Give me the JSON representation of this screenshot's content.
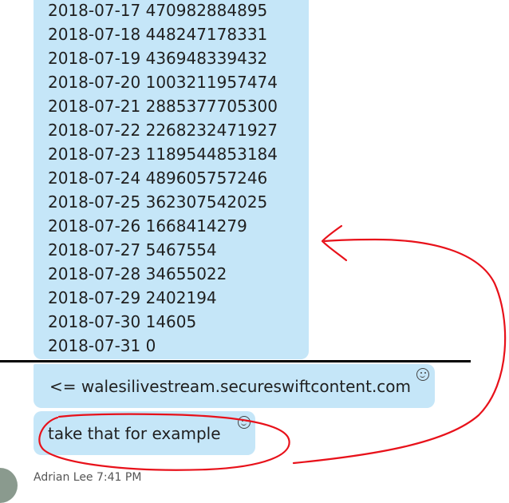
{
  "chat": {
    "log_lines": [
      "2018-07-17 470982884895",
      "2018-07-18 448247178331",
      "2018-07-19 436948339432",
      "2018-07-20 1003211957474",
      "2018-07-21 2885377705300",
      "2018-07-22 2268232471927",
      "2018-07-23 1189544853184",
      "2018-07-24 489605757246",
      "2018-07-25 362307542025",
      "2018-07-26 1668414279",
      "2018-07-27 5467554",
      "2018-07-28 34655022",
      "2018-07-29 2402194",
      "2018-07-30 14605",
      "2018-07-31 0"
    ],
    "domain_message": "<= walesilivestream.secureswiftcontent.com",
    "example_message": "take that for example",
    "next_sender": "Adrian Lee  7:41 PM"
  },
  "colors": {
    "bubble": "#c5e6f8",
    "annotation": "#e8111a"
  },
  "icons": {
    "reaction": "smiley-icon"
  }
}
